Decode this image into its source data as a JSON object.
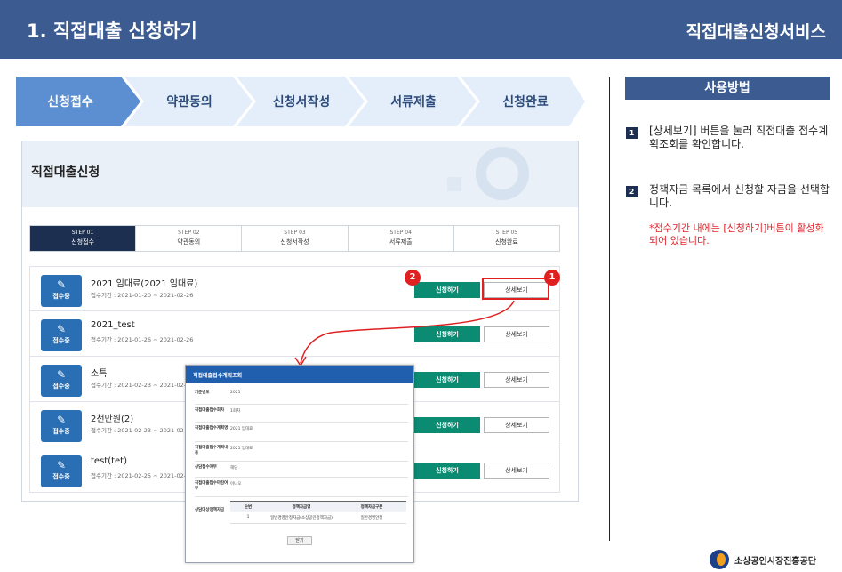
{
  "header": {
    "title": "1. 직접대출 신청하기",
    "service": "직접대출신청서비스"
  },
  "flow_steps": [
    "신청접수",
    "약관동의",
    "신청서작성",
    "서류제출",
    "신청완료"
  ],
  "panel": {
    "title": "직접대출신청",
    "tabs": [
      {
        "step": "STEP 01",
        "name": "신청접수"
      },
      {
        "step": "STEP 02",
        "name": "약관동의"
      },
      {
        "step": "STEP 03",
        "name": "신청서작성"
      },
      {
        "step": "STEP 04",
        "name": "서류제출"
      },
      {
        "step": "STEP 05",
        "name": "신청완료"
      }
    ],
    "status_label": "접수중",
    "apply_label": "신청하기",
    "detail_label": "상세보기",
    "items": [
      {
        "name": "2021 임대료(2021 임대료)",
        "period": "접수기간 : 2021-01-20 ~ 2021-02-26"
      },
      {
        "name": "2021_test",
        "period": "접수기간 : 2021-01-26 ~ 2021-02-26"
      },
      {
        "name": "소특",
        "period": "접수기간 : 2021-02-23 ~ 2021-02-26"
      },
      {
        "name": "2천만원(2)",
        "period": "접수기간 : 2021-02-23 ~ 2021-02-26"
      },
      {
        "name": "test(tet)",
        "period": "접수기간 : 2021-02-25 ~ 2021-02-26"
      }
    ]
  },
  "popup": {
    "title": "직접대출접수계획조회",
    "rows": [
      {
        "label": "기준년도",
        "value": "2021"
      },
      {
        "label": "직접대출접수회차",
        "value": "1회차"
      },
      {
        "label": "직접대출접수계획명",
        "value": "2021 임대료"
      },
      {
        "label": "직접대출접수계획내용",
        "value": "2021 임대료"
      },
      {
        "label": "상담접수여부",
        "value": "해당"
      },
      {
        "label": "직접대출접수마감여부",
        "value": "아니오"
      }
    ],
    "table_label": "상담대상정책자금",
    "table_headers": [
      "순번",
      "정책자금명",
      "정책자금구분"
    ],
    "table_row": [
      "1",
      "일반경영안정자금(소상공인정책자금)",
      "일반경영안정"
    ],
    "close_label": "닫기"
  },
  "usage": {
    "title": "사용방법",
    "steps": [
      {
        "num": "1",
        "text": "[상세보기] 버튼을 눌러 직접대출 접수계획조회를 확인합니다."
      },
      {
        "num": "2",
        "text": "정책자금 목록에서 신청할 자금을 선택합니다."
      }
    ],
    "note": "*접수기간 내에는 [신청하기]버튼이 활성화 되어 있습니다."
  },
  "badges": {
    "one": "1",
    "two": "2"
  },
  "footer": {
    "org": "소상공인시장진흥공단"
  },
  "colors": {
    "banner": "#3b5b91",
    "flow_active": "#5b8fd1",
    "flow_inactive": "#e4eefa",
    "apply": "#0c8b73",
    "tab_active": "#1c2f50",
    "highlight": "#e02020"
  }
}
